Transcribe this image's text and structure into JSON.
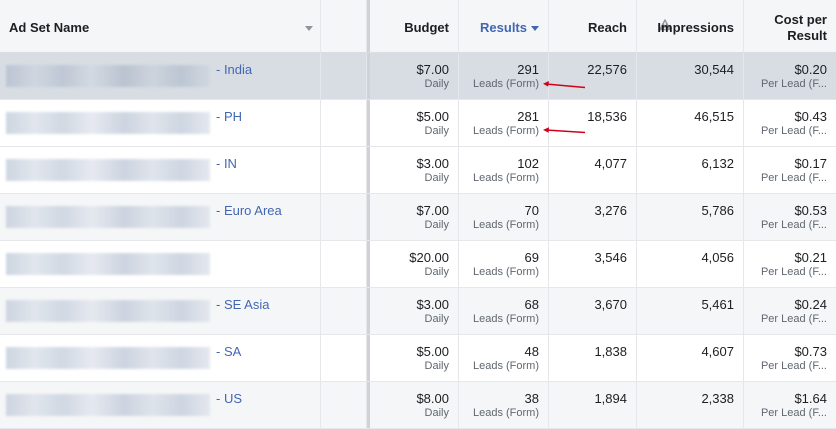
{
  "header": {
    "ad_set_name": "Ad Set Name",
    "budget": "Budget",
    "results": "Results",
    "reach": "Reach",
    "impressions": "Impressions",
    "cost_per_result_line1": "Cost per",
    "cost_per_result_line2": "Result"
  },
  "colors": {
    "accent": "#4267b2",
    "annotation_arrow": "#d0021b"
  },
  "rows": [
    {
      "name_suffix": "- India",
      "budget": "$7.00",
      "budget_type": "Daily",
      "results": "291",
      "results_type": "Leads (Form)",
      "reach": "22,576",
      "impressions": "30,544",
      "cost": "$0.20",
      "cost_type": "Per Lead (F..."
    },
    {
      "name_suffix": "- PH",
      "budget": "$5.00",
      "budget_type": "Daily",
      "results": "281",
      "results_type": "Leads (Form)",
      "reach": "18,536",
      "impressions": "46,515",
      "cost": "$0.43",
      "cost_type": "Per Lead (F..."
    },
    {
      "name_suffix": "- IN",
      "budget": "$3.00",
      "budget_type": "Daily",
      "results": "102",
      "results_type": "Leads (Form)",
      "reach": "4,077",
      "impressions": "6,132",
      "cost": "$0.17",
      "cost_type": "Per Lead (F..."
    },
    {
      "name_suffix": "- Euro Area",
      "budget": "$7.00",
      "budget_type": "Daily",
      "results": "70",
      "results_type": "Leads (Form)",
      "reach": "3,276",
      "impressions": "5,786",
      "cost": "$0.53",
      "cost_type": "Per Lead (F..."
    },
    {
      "name_suffix": "",
      "budget": "$20.00",
      "budget_type": "Daily",
      "results": "69",
      "results_type": "Leads (Form)",
      "reach": "3,546",
      "impressions": "4,056",
      "cost": "$0.21",
      "cost_type": "Per Lead (F..."
    },
    {
      "name_suffix": "- SE Asia",
      "budget": "$3.00",
      "budget_type": "Daily",
      "results": "68",
      "results_type": "Leads (Form)",
      "reach": "3,670",
      "impressions": "5,461",
      "cost": "$0.24",
      "cost_type": "Per Lead (F..."
    },
    {
      "name_suffix": "- SA",
      "budget": "$5.00",
      "budget_type": "Daily",
      "results": "48",
      "results_type": "Leads (Form)",
      "reach": "1,838",
      "impressions": "4,607",
      "cost": "$0.73",
      "cost_type": "Per Lead (F..."
    },
    {
      "name_suffix": "- US",
      "budget": "$8.00",
      "budget_type": "Daily",
      "results": "38",
      "results_type": "Leads (Form)",
      "reach": "1,894",
      "impressions": "2,338",
      "cost": "$1.64",
      "cost_type": "Per Lead (F..."
    }
  ]
}
